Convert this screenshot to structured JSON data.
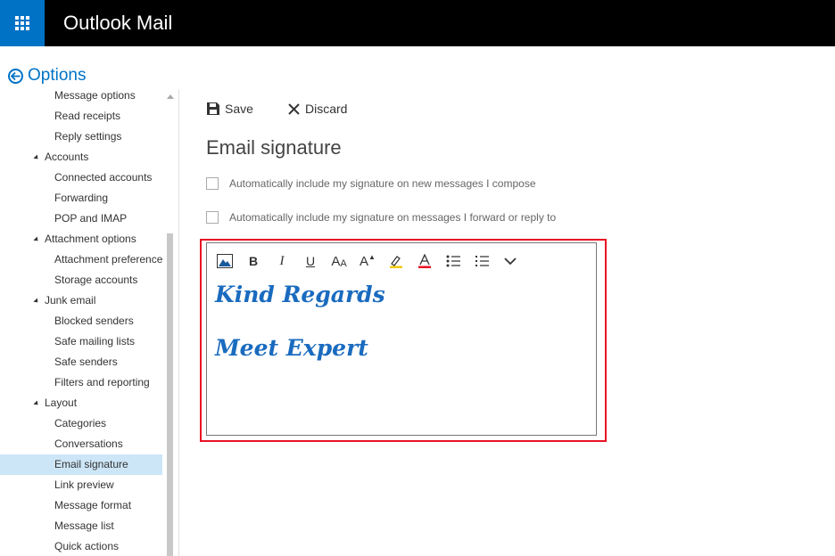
{
  "app": {
    "title": "Outlook Mail"
  },
  "options": {
    "label": "Options"
  },
  "sidebar": {
    "items": [
      {
        "label": "Message options"
      },
      {
        "label": "Read receipts"
      },
      {
        "label": "Reply settings"
      },
      {
        "label": "Accounts"
      },
      {
        "label": "Connected accounts"
      },
      {
        "label": "Forwarding"
      },
      {
        "label": "POP and IMAP"
      },
      {
        "label": "Attachment options"
      },
      {
        "label": "Attachment preferences"
      },
      {
        "label": "Storage accounts"
      },
      {
        "label": "Junk email"
      },
      {
        "label": "Blocked senders"
      },
      {
        "label": "Safe mailing lists"
      },
      {
        "label": "Safe senders"
      },
      {
        "label": "Filters and reporting"
      },
      {
        "label": "Layout"
      },
      {
        "label": "Categories"
      },
      {
        "label": "Conversations"
      },
      {
        "label": "Email signature"
      },
      {
        "label": "Link preview"
      },
      {
        "label": "Message format"
      },
      {
        "label": "Message list"
      },
      {
        "label": "Quick actions"
      }
    ]
  },
  "commands": {
    "save": "Save",
    "discard": "Discard"
  },
  "page": {
    "title": "Email signature",
    "option_new": "Automatically include my signature on new messages I compose",
    "option_reply": "Automatically include my signature on messages I forward or reply to"
  },
  "editor": {
    "toolbar_icons": [
      "insert-picture-icon",
      "bold-icon",
      "italic-icon",
      "underline-icon",
      "font-size-icon",
      "grow-font-icon",
      "highlight-icon",
      "font-color-icon",
      "bullets-icon",
      "numbering-icon",
      "more-options-icon"
    ],
    "line1": "Kind Regards",
    "line2": "Meet Expert"
  },
  "colors": {
    "brand_blue": "#0072c6",
    "signature_blue": "#1a6bbf",
    "highlight_red": "#e81123",
    "selected_bg": "#cde6f7"
  }
}
